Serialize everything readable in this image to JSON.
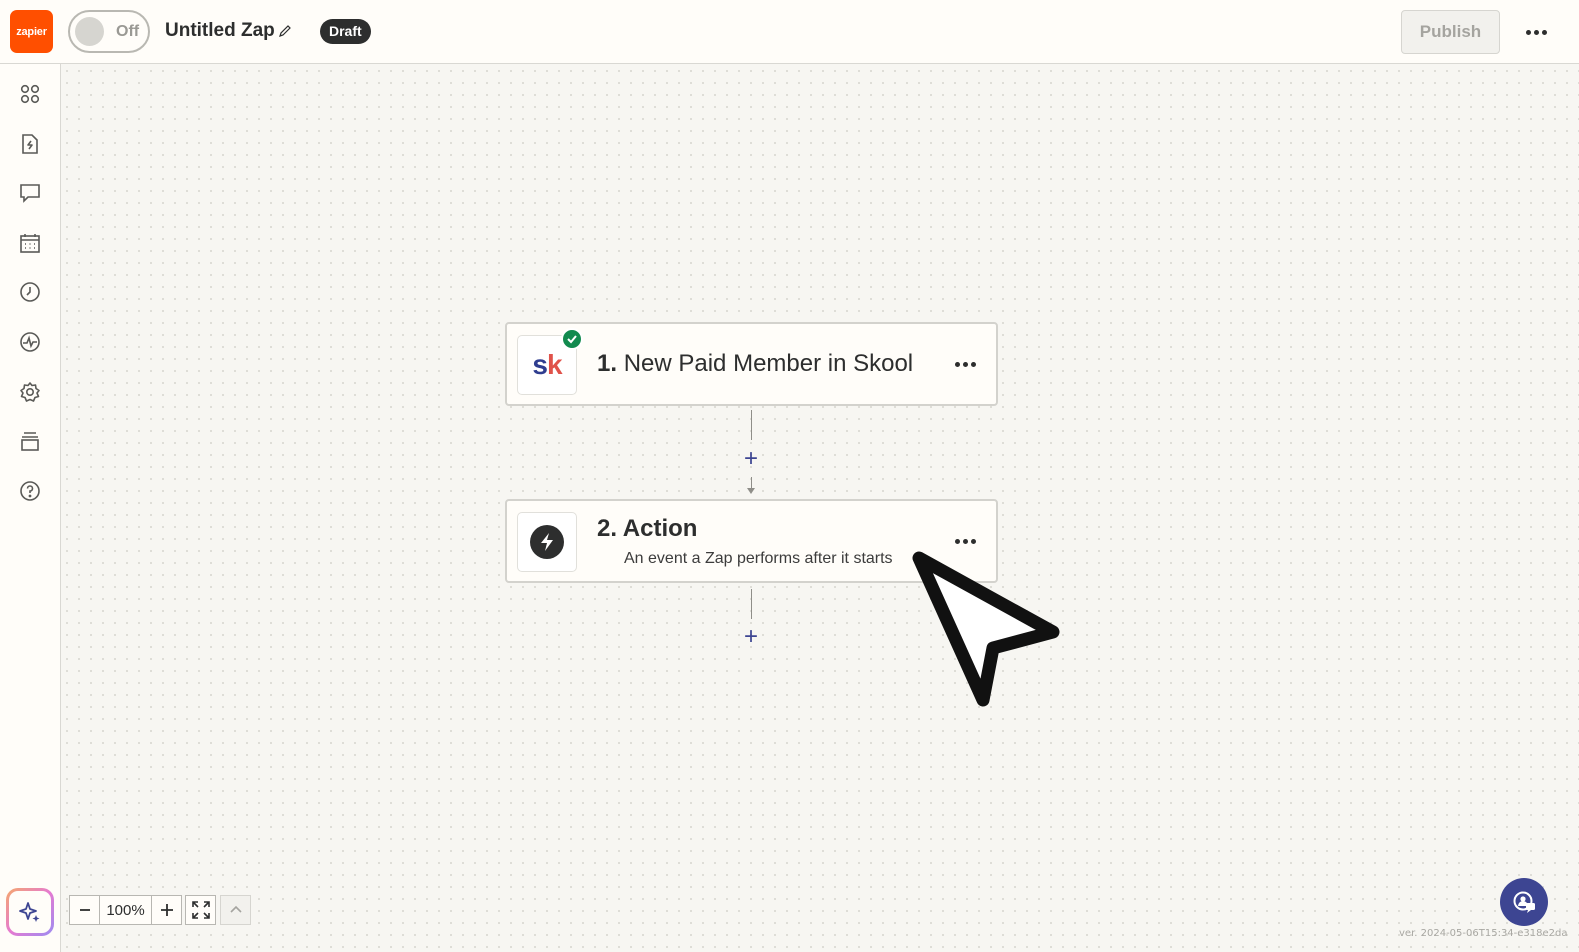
{
  "app": {
    "logo_text": "zapier",
    "brand_color": "#ff4f00"
  },
  "header": {
    "toggle_label": "Off",
    "zap_title": "Untitled Zap",
    "status_badge": "Draft",
    "publish_label": "Publish"
  },
  "sidebar": {
    "items": [
      {
        "icon": "apps-icon"
      },
      {
        "icon": "zap-file-icon"
      },
      {
        "icon": "comment-icon"
      },
      {
        "icon": "calendar-icon"
      },
      {
        "icon": "history-icon"
      },
      {
        "icon": "activity-icon"
      },
      {
        "icon": "settings-icon"
      },
      {
        "icon": "versions-icon"
      },
      {
        "icon": "help-icon"
      }
    ],
    "ai_icon": "sparkle-icon"
  },
  "steps": [
    {
      "number": "1.",
      "title": "New Paid Member in Skool",
      "app_logo": "sk",
      "status": "complete"
    },
    {
      "number": "2.",
      "title": "Action",
      "subtitle": "An event a Zap performs after it starts"
    }
  ],
  "zoom": {
    "value": "100%"
  },
  "footer": {
    "version": "ver. 2024-05-06T15:34-e318e2da"
  },
  "colors": {
    "accent": "#3d4592",
    "success": "#128a4e",
    "text": "#2d2e2e"
  }
}
